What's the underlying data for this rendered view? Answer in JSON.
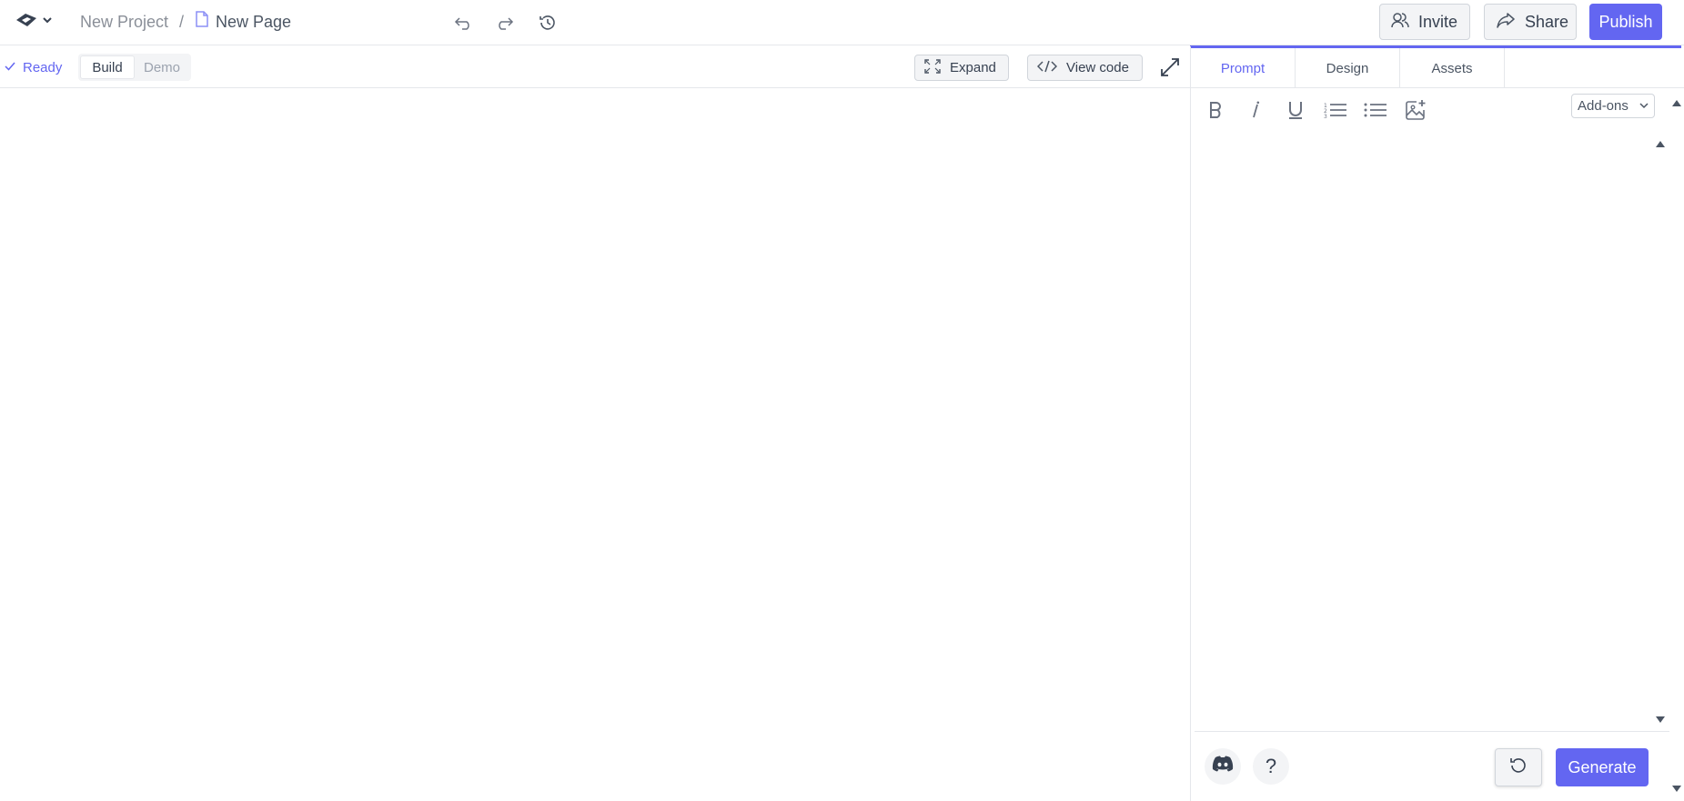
{
  "header": {
    "breadcrumb": {
      "project": "New Project",
      "separator": "/",
      "page": "New Page"
    },
    "invite_label": "Invite",
    "share_label": "Share",
    "publish_label": "Publish"
  },
  "subbar": {
    "status_label": "Ready",
    "mode_build_label": "Build",
    "mode_demo_label": "Demo",
    "expand_label": "Expand",
    "view_code_label": "View code"
  },
  "panel": {
    "tabs": [
      {
        "label": "Prompt",
        "active": true
      },
      {
        "label": "Design",
        "active": false
      },
      {
        "label": "Assets",
        "active": false
      }
    ],
    "addons_label": "Add-ons",
    "help_label": "?",
    "generate_label": "Generate"
  },
  "icons": {
    "logo": "logo-icon",
    "undo": "undo-icon",
    "redo": "redo-icon",
    "history": "history-icon",
    "invite": "users-icon",
    "share": "share-icon",
    "expand": "expand-icon",
    "code": "code-icon",
    "fullscreen": "arrows-expand-icon",
    "bold": "bold-icon",
    "italic": "italic-icon",
    "underline": "underline-icon",
    "ordered_list": "ordered-list-icon",
    "bullet_list": "bullet-list-icon",
    "add_image": "add-image-icon",
    "discord": "discord-icon",
    "reset": "reset-icon"
  },
  "colors": {
    "accent": "#6366f1",
    "border": "#e5e7eb",
    "button_bg": "#f3f4f6"
  }
}
